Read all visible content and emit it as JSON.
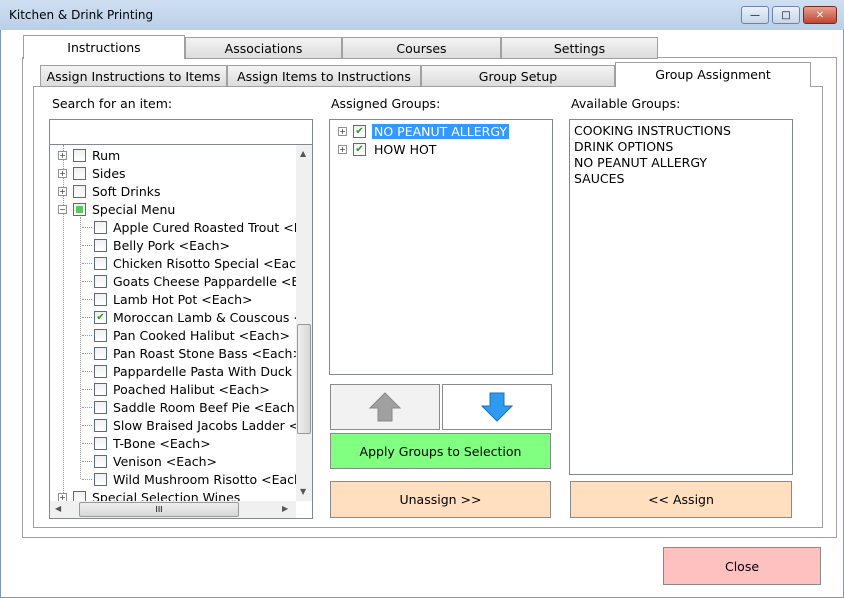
{
  "window": {
    "title": "Kitchen & Drink Printing",
    "minimize": "—",
    "maximize": "□",
    "close": "✕"
  },
  "top_tabs": [
    {
      "label": "Instructions",
      "selected": true
    },
    {
      "label": "Associations"
    },
    {
      "label": "Courses"
    },
    {
      "label": "Settings"
    }
  ],
  "sub_tabs": [
    {
      "label": "Assign Instructions to Items"
    },
    {
      "label": "Assign Items to Instructions"
    },
    {
      "label": "Group Setup"
    },
    {
      "label": "Group Assignment",
      "selected": true
    }
  ],
  "search": {
    "label": "Search for an item:",
    "value": "",
    "placeholder": ""
  },
  "item_tree": [
    {
      "label": "Rum",
      "level": 0,
      "expander": "+",
      "checked": false
    },
    {
      "label": "Sides",
      "level": 0,
      "expander": "+",
      "checked": false
    },
    {
      "label": "Soft Drinks",
      "level": 0,
      "expander": "+",
      "checked": false
    },
    {
      "label": "Special Menu",
      "level": 0,
      "expander": "-",
      "checked": "partial"
    },
    {
      "label": "Apple Cured Roasted Trout <Ea",
      "level": 1,
      "checked": false
    },
    {
      "label": "Belly Pork <Each>",
      "level": 1,
      "checked": false
    },
    {
      "label": "Chicken Risotto Special <Each>",
      "level": 1,
      "checked": false
    },
    {
      "label": "Goats Cheese Pappardelle <Eac",
      "level": 1,
      "checked": false
    },
    {
      "label": "Lamb Hot Pot <Each>",
      "level": 1,
      "checked": false
    },
    {
      "label": "Moroccan Lamb & Couscous <E",
      "level": 1,
      "checked": true
    },
    {
      "label": "Pan Cooked Halibut <Each>",
      "level": 1,
      "checked": false
    },
    {
      "label": "Pan Roast Stone Bass <Each>",
      "level": 1,
      "checked": false
    },
    {
      "label": "Pappardelle Pasta With Duck Co",
      "level": 1,
      "checked": false
    },
    {
      "label": "Poached Halibut <Each>",
      "level": 1,
      "checked": false
    },
    {
      "label": "Saddle Room Beef Pie <Each>",
      "level": 1,
      "checked": false
    },
    {
      "label": "Slow Braised Jacobs Ladder <Ea",
      "level": 1,
      "checked": false
    },
    {
      "label": "T-Bone <Each>",
      "level": 1,
      "checked": false
    },
    {
      "label": "Venison <Each>",
      "level": 1,
      "checked": false
    },
    {
      "label": "Wild Mushroom Risotto <Each>",
      "level": 1,
      "checked": false
    },
    {
      "label": "Special Selection Wines",
      "level": 0,
      "expander": "+",
      "checked": false
    }
  ],
  "assigned": {
    "label": "Assigned Groups:",
    "items": [
      {
        "label": "NO PEANUT ALLERGY",
        "checked": true,
        "selected": true
      },
      {
        "label": "HOW HOT",
        "checked": true
      }
    ]
  },
  "available": {
    "label": "Available Groups:",
    "items": [
      "COOKING INSTRUCTIONS",
      "DRINK OPTIONS",
      "NO PEANUT ALLERGY",
      "SAUCES"
    ]
  },
  "buttons": {
    "apply": "Apply Groups to Selection",
    "unassign": "Unassign >>",
    "assign": "<< Assign",
    "close": "Close",
    "scroll_grip": "III"
  },
  "colors": {
    "apply": "#80ff80",
    "assign": "#ffdfc0",
    "close": "#ffc0c0",
    "selection": "#3399ff",
    "up_arrow": "#a0a0a0",
    "down_arrow": "#2d9cf0"
  }
}
